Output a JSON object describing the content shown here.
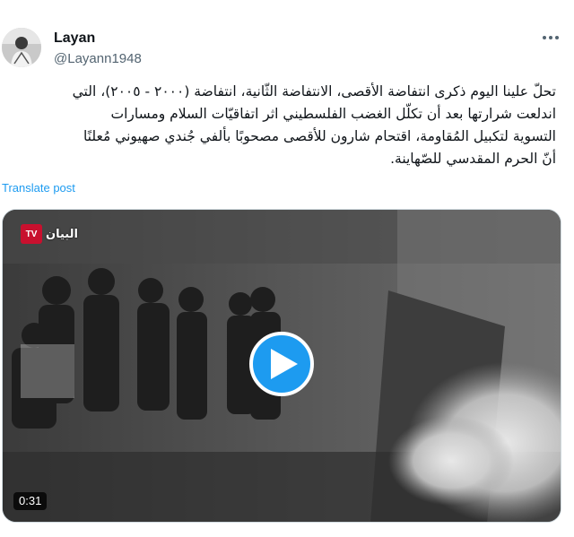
{
  "author": {
    "name": "Layan",
    "handle": "@Layann1948"
  },
  "tweet": {
    "lines": [
      "تحلّ علينا اليوم ذكرى انتفاضة الأقصى، الانتفاضة الثّانية، انتفاضة (٢٠٠٠ - ٢٠٠٥)، التي",
      "اندلعت شرارتها بعد أن تكلّل الغضب الفلسطيني اثر اتفاقيّات السلام ومسارات",
      "التسوية لتكبيل المُقاومة، اقتحام شارون للأقصى مصحوبًا بألفي جُندي صهيوني مُعلنًا",
      "أنّ الحرم المقدسي للصّهاينة."
    ],
    "translate_label": "Translate post"
  },
  "video": {
    "duration": "0:31",
    "channel_logo_text": "البيان",
    "tv_badge": "TV",
    "play_icon": "play-icon"
  },
  "icons": {
    "more": "more-options-icon"
  },
  "colors": {
    "accent": "#1d9bf0",
    "secondary_text": "#536471",
    "primary_text": "#0f1419"
  }
}
